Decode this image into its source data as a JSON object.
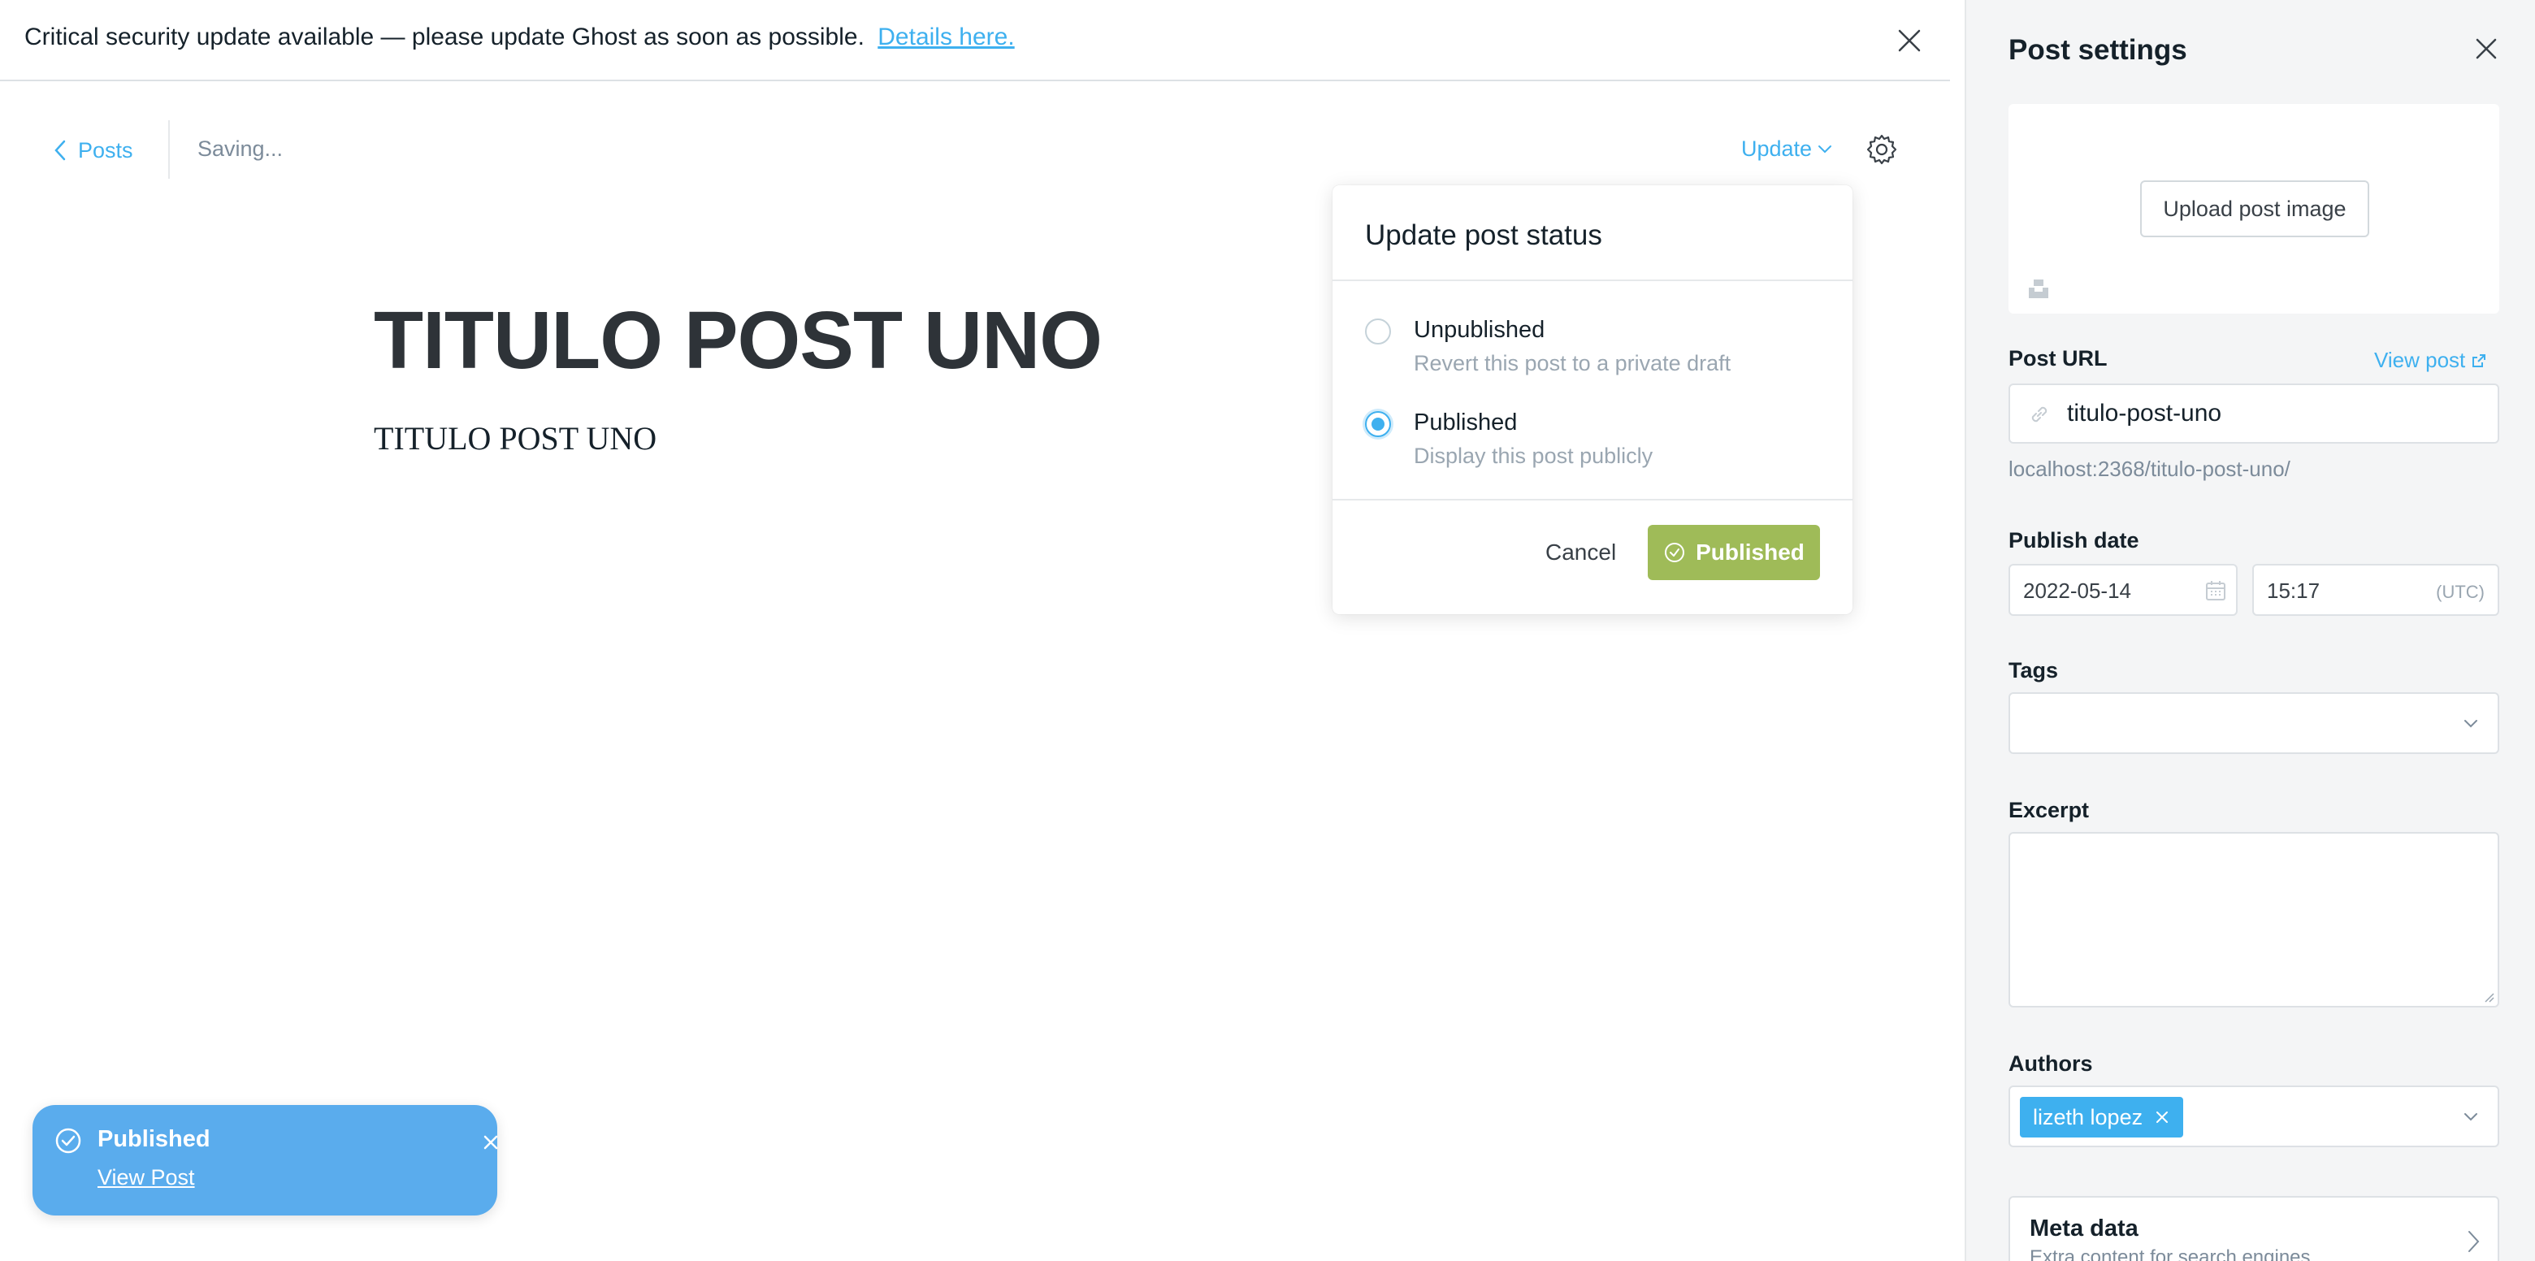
{
  "banner": {
    "text": "Critical security update available — please update Ghost as soon as possible.",
    "link_label": "Details here."
  },
  "editor_header": {
    "back_label": "Posts",
    "status_text": "Saving...",
    "update_label": "Update"
  },
  "post": {
    "title": "TITULO POST UNO",
    "body": "TITULO POST UNO"
  },
  "status_dropdown": {
    "title": "Update post status",
    "options": [
      {
        "label": "Unpublished",
        "description": "Revert this post to a private draft",
        "selected": false
      },
      {
        "label": "Published",
        "description": "Display this post publicly",
        "selected": true
      }
    ],
    "cancel_label": "Cancel",
    "confirm_label": "Published"
  },
  "toast": {
    "title": "Published",
    "link_label": "View Post"
  },
  "settings": {
    "title": "Post settings",
    "upload_label": "Upload post image",
    "post_url_label": "Post URL",
    "view_post_label": "View post",
    "slug": "titulo-post-uno",
    "url_hint": "localhost:2368/titulo-post-uno/",
    "publish_date_label": "Publish date",
    "date": "2022-05-14",
    "time": "15:17",
    "timezone": "(UTC)",
    "tags_label": "Tags",
    "excerpt_label": "Excerpt",
    "authors_label": "Authors",
    "author": "lizeth lopez",
    "meta_title": "Meta data",
    "meta_desc": "Extra content for search engines"
  },
  "colors": {
    "accent": "#3eb0ef",
    "published_green": "#9fbb58",
    "toast_blue": "#5aaced"
  }
}
